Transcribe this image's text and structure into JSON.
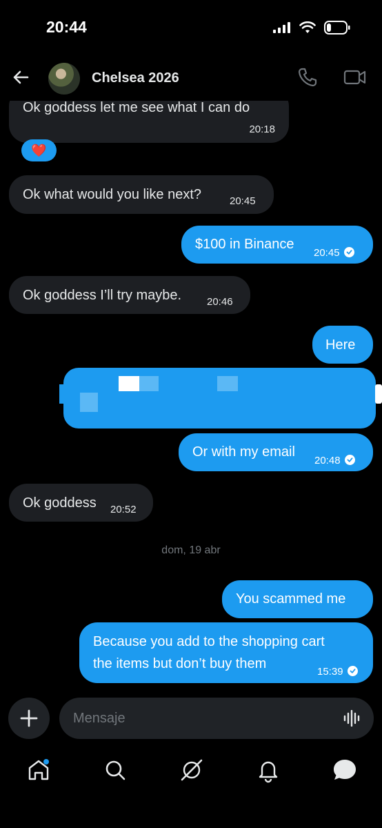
{
  "status": {
    "time": "20:44"
  },
  "header": {
    "contact_name": "Chelsea 2026"
  },
  "messages": [
    {
      "text": "Ok goddess let me see what I can do",
      "time": "20:18"
    },
    {
      "reaction": "❤️"
    },
    {
      "text": "Ok what would you like next?",
      "time": "20:45"
    },
    {
      "text": "$100 in Binance",
      "time": "20:45"
    },
    {
      "text": "Ok goddess I’ll try maybe.",
      "time": "20:46"
    },
    {
      "text": "Here"
    },
    {
      "text": "Or with my email",
      "time": "20:48"
    },
    {
      "text": "Ok goddess",
      "time": "20:52"
    },
    {
      "text": "You scammed me"
    },
    {
      "line1": "Because you add to the shopping cart",
      "line2": "the items but don’t buy them",
      "time": "15:39"
    }
  ],
  "date_separator": "dom, 19 abr",
  "composer": {
    "placeholder": "Mensaje"
  },
  "colors": {
    "sent_bubble": "#1d9bf0",
    "received_bubble": "#1d1f23",
    "background": "#000000"
  },
  "icons": [
    "back-arrow-icon",
    "phone-icon",
    "video-camera-icon",
    "plus-icon",
    "voice-waveform-icon",
    "home-icon",
    "search-icon",
    "grok-icon",
    "bell-icon",
    "messages-icon"
  ]
}
